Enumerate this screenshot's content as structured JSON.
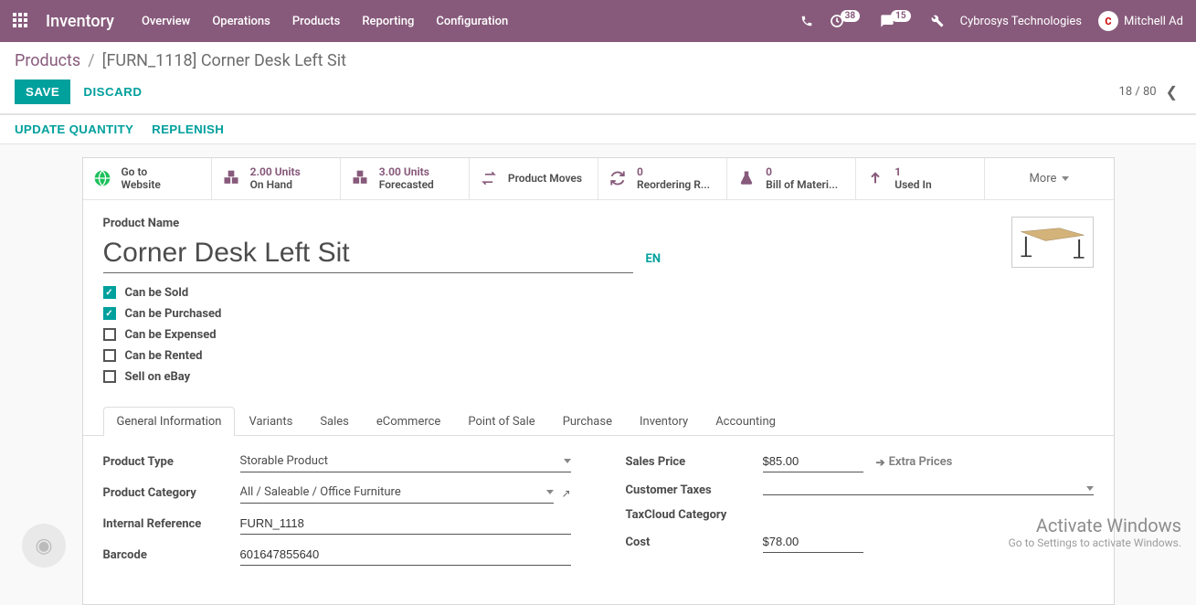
{
  "topnav": {
    "module": "Inventory",
    "links": [
      "Overview",
      "Operations",
      "Products",
      "Reporting",
      "Configuration"
    ],
    "badge_clock": "38",
    "badge_msg": "15",
    "company": "Cybrosys Technologies",
    "user": "Mitchell Ad",
    "user_initial": "C"
  },
  "breadcrumb": {
    "parent": "Products",
    "current": "[FURN_1118] Corner Desk Left Sit"
  },
  "buttons": {
    "save": "SAVE",
    "discard": "DISCARD",
    "update_qty": "UPDATE QUANTITY",
    "replenish": "REPLENISH"
  },
  "pager": {
    "text": "18 / 80"
  },
  "stats": {
    "website": {
      "l1": "Go to",
      "l2": "Website"
    },
    "onhand": {
      "val": "2.00 Units",
      "lbl": "On Hand"
    },
    "forecast": {
      "val": "3.00 Units",
      "lbl": "Forecasted"
    },
    "moves": {
      "lbl": "Product Moves"
    },
    "reorder": {
      "val": "0",
      "lbl": "Reordering R..."
    },
    "bom": {
      "val": "0",
      "lbl": "Bill of Materi..."
    },
    "usedin": {
      "val": "1",
      "lbl": "Used In"
    },
    "more": "More"
  },
  "product": {
    "name_label": "Product Name",
    "name": "Corner Desk Left Sit",
    "lang": "EN",
    "checks": {
      "sold": "Can be Sold",
      "purchased": "Can be Purchased",
      "expensed": "Can be Expensed",
      "rented": "Can be Rented",
      "ebay": "Sell on eBay"
    }
  },
  "tabs": [
    "General Information",
    "Variants",
    "Sales",
    "eCommerce",
    "Point of Sale",
    "Purchase",
    "Inventory",
    "Accounting"
  ],
  "fields": {
    "left": {
      "type_label": "Product Type",
      "type_val": "Storable Product",
      "cat_label": "Product Category",
      "cat_val": "All / Saleable / Office Furniture",
      "ref_label": "Internal Reference",
      "ref_val": "FURN_1118",
      "barcode_label": "Barcode",
      "barcode_val": "601647855640"
    },
    "right": {
      "sp_label": "Sales Price",
      "sp_val": "$85.00",
      "extra": "Extra Prices",
      "ct_label": "Customer Taxes",
      "tc_label": "TaxCloud Category",
      "cost_label": "Cost",
      "cost_val": "$78.00"
    }
  },
  "watermark": {
    "t1": "Activate Windows",
    "t2": "Go to Settings to activate Windows."
  }
}
